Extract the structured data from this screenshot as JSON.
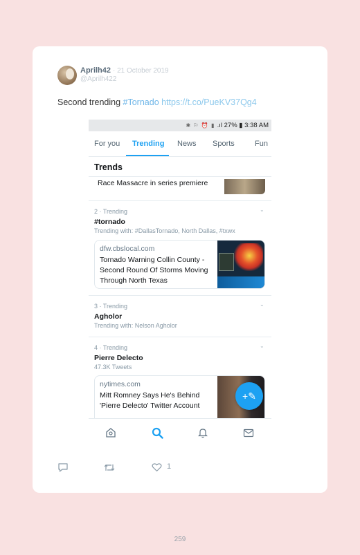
{
  "tweet": {
    "username": "Aprilh42",
    "date": "· 21 October 2019",
    "handle": "@Aprilh422",
    "text_plain": "Second trending ",
    "hashtag": "#Tornado",
    "url": " https://t.co/PueKV37Qg4",
    "likes": "1"
  },
  "status_bar": {
    "icons": "✱ ⚐ ⏰ ▮ ",
    "battery": ".ıl 27% ▮ 3:38 AM"
  },
  "tabs": [
    "For you",
    "Trending",
    "News",
    "Sports",
    "Fun"
  ],
  "trends_title": "Trends",
  "previous_item": "Race Massacre in series premiere",
  "trends": [
    {
      "rank_line": "2 · Trending",
      "title": "#tornado",
      "sub": "Trending with: #DallasTornado, North Dallas, #txwx",
      "card": {
        "source": "dfw.cbslocal.com",
        "headline": "Tornado Warning Collin County - Second Round Of Storms Moving Through North Texas"
      }
    },
    {
      "rank_line": "3 · Trending",
      "title": "Agholor",
      "sub": "Trending with: Nelson Agholor"
    },
    {
      "rank_line": "4 · Trending",
      "title": "Pierre Delecto",
      "sub": "47.3K Tweets",
      "card": {
        "source": "nytimes.com",
        "headline": "Mitt Romney Says He's Behind 'Pierre Delecto' Twitter Account"
      }
    }
  ],
  "fab_icon": "+✎",
  "chevron": "⌄",
  "page_number": "259"
}
